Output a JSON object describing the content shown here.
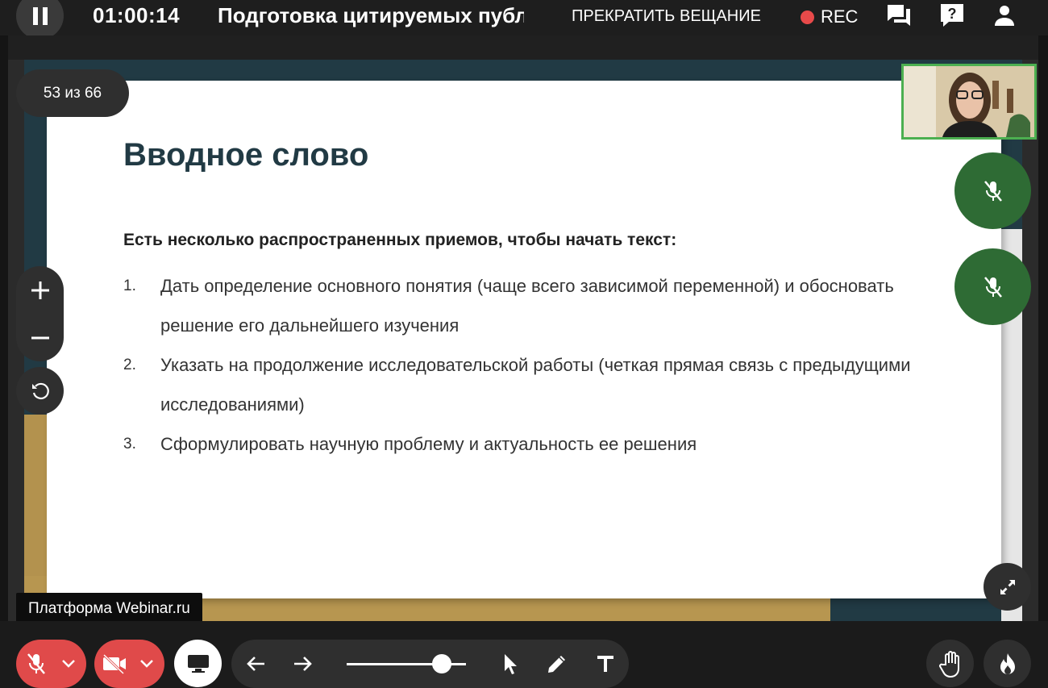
{
  "topbar": {
    "timer": "01:00:14",
    "title": "Подготовка цитируемых публикаций",
    "stop_broadcast": "ПРЕКРАТИТЬ ВЕЩАНИЕ",
    "rec_label": "REC",
    "rec_color": "#e84a4a",
    "icons": [
      "pause-icon",
      "chat-icon",
      "help-icon",
      "user-icon"
    ]
  },
  "slide": {
    "counter": "53 из 66",
    "heading": "Вводное слово",
    "lead": "Есть несколько распространенных приемов, чтобы начать текст:",
    "items": [
      {
        "num": "1.",
        "text": "Дать определение основного понятия (чаще всего зависимой переменной) и обосновать решение его дальнейшего изучения"
      },
      {
        "num": "2.",
        "text": "Указать на продолжение исследовательской работы (четкая прямая связь с предыдущими исследованиями)"
      },
      {
        "num": "3.",
        "text": "Сформулировать научную проблему и актуальность ее решения"
      }
    ]
  },
  "platform_tag": "Платформа Webinar.ru",
  "colors": {
    "accent_green": "#2e6b34",
    "camera_border": "#4caf50",
    "danger_red": "#e04a4a",
    "slide_dark": "#213a44",
    "slide_gold": "#b79650"
  },
  "controls": {
    "zoom_icons": [
      "plus-icon",
      "minus-icon",
      "reset-icon"
    ],
    "bottom_icons": [
      "mic-off-icon",
      "camera-off-icon",
      "screen-share-icon",
      "arrow-left-icon",
      "arrow-right-icon",
      "cursor-icon",
      "pencil-icon",
      "text-icon",
      "hand-icon",
      "fire-icon"
    ],
    "slider_level_percent": 81
  }
}
